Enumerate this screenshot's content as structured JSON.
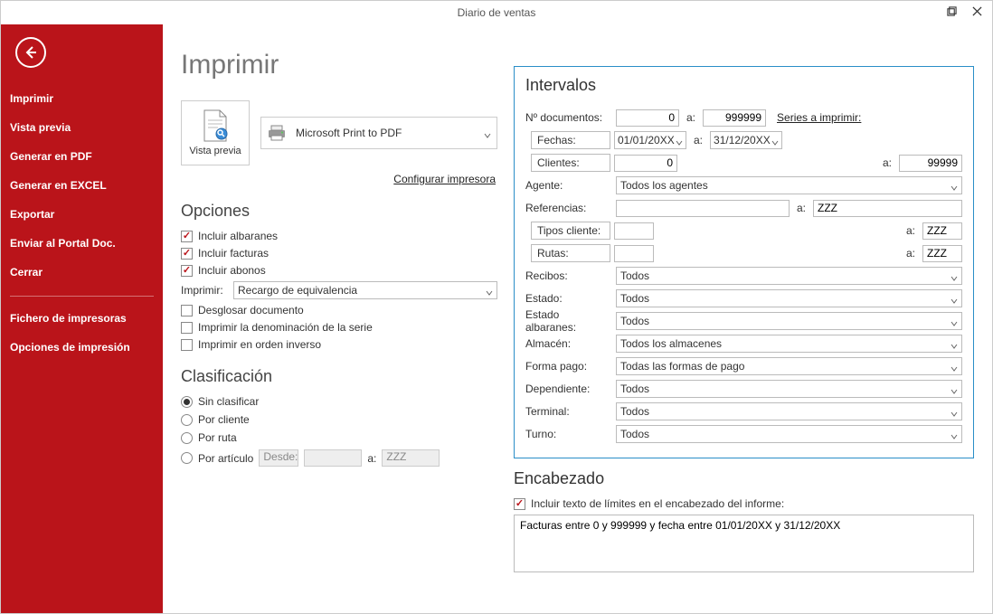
{
  "window": {
    "title": "Diario de ventas"
  },
  "sidebar": {
    "items1": [
      {
        "label": "Imprimir"
      },
      {
        "label": "Vista previa"
      },
      {
        "label": "Generar en PDF"
      },
      {
        "label": "Generar en EXCEL"
      },
      {
        "label": "Exportar"
      },
      {
        "label": "Enviar al Portal Doc."
      },
      {
        "label": "Cerrar"
      }
    ],
    "items2": [
      {
        "label": "Fichero de impresoras"
      },
      {
        "label": "Opciones de impresión"
      }
    ]
  },
  "page": {
    "title": "Imprimir",
    "preview_label": "Vista previa",
    "printer_name": "Microsoft Print to PDF",
    "config_link": "Configurar impresora"
  },
  "options": {
    "heading": "Opciones",
    "c1": "Incluir albaranes",
    "c2": "Incluir facturas",
    "c3": "Incluir abonos",
    "imprimir_label": "Imprimir:",
    "imprimir_value": "Recargo de equivalencia",
    "c4": "Desglosar documento",
    "c5": "Imprimir la denominación de la serie",
    "c6": "Imprimir en orden inverso"
  },
  "classification": {
    "heading": "Clasificación",
    "r1": "Sin clasificar",
    "r2": "Por cliente",
    "r3": "Por ruta",
    "r4": "Por artículo",
    "desde": "Desde:",
    "a": "a:",
    "a_val": "ZZZ"
  },
  "intervals": {
    "heading": "Intervalos",
    "ndoc_label": "Nº documentos:",
    "ndoc_from": "0",
    "ndoc_to": "999999",
    "a": "a:",
    "series_link": "Series a imprimir:",
    "fechas_label": "Fechas:",
    "fecha_from": "01/01/20XX",
    "fecha_to": "31/12/20XX",
    "clientes_label": "Clientes:",
    "cli_from": "0",
    "cli_to": "99999",
    "agente_label": "Agente:",
    "agente_val": "Todos los agentes",
    "ref_label": "Referencias:",
    "ref_to": "ZZZ",
    "tipos_label": "Tipos cliente:",
    "tipos_to": "ZZZ",
    "rutas_label": "Rutas:",
    "rutas_to": "ZZZ",
    "recibos_label": "Recibos:",
    "recibos_val": "Todos",
    "estado_label": "Estado:",
    "estado_val": "Todos",
    "estado_alb_label": "Estado albaranes:",
    "estado_alb_val": "Todos",
    "almacen_label": "Almacén:",
    "almacen_val": "Todos los almacenes",
    "forma_label": "Forma pago:",
    "forma_val": "Todas las formas de pago",
    "dep_label": "Dependiente:",
    "dep_val": "Todos",
    "terminal_label": "Terminal:",
    "terminal_val": "Todos",
    "turno_label": "Turno:",
    "turno_val": "Todos"
  },
  "header_section": {
    "heading": "Encabezado",
    "chk_label": "Incluir texto de límites en el encabezado del informe:",
    "text": "Facturas entre 0 y 999999 y fecha entre 01/01/20XX y 31/12/20XX"
  }
}
